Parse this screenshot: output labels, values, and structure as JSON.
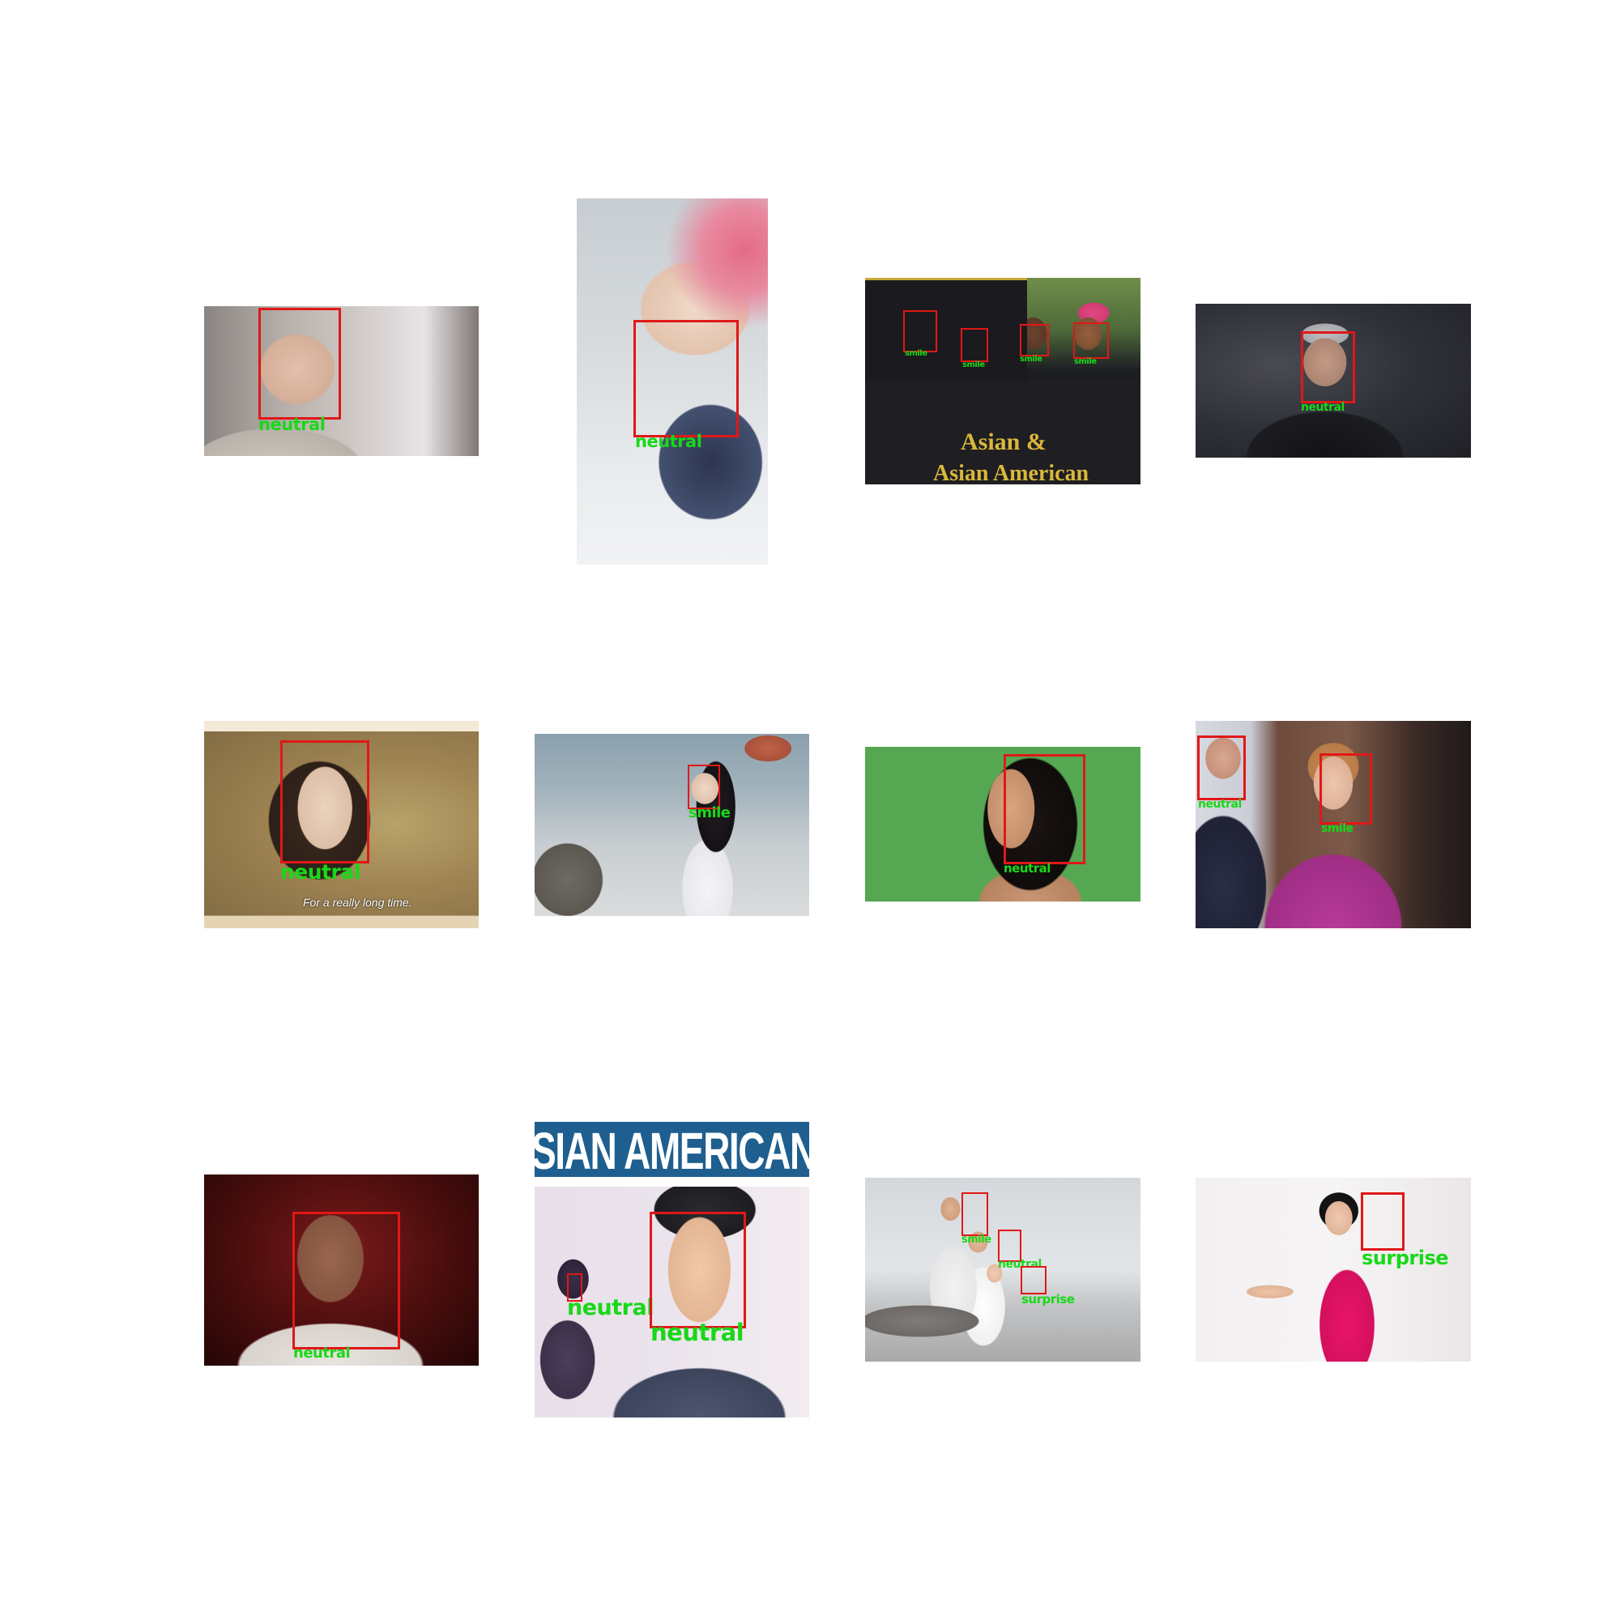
{
  "tiles": [
    {
      "id": "r1c1",
      "faces": [
        {
          "label": "neutral"
        }
      ],
      "overlay": []
    },
    {
      "id": "r1c2",
      "faces": [
        {
          "label": "neutral"
        }
      ],
      "overlay": []
    },
    {
      "id": "r1c3",
      "faces": [
        {
          "label": "smile"
        },
        {
          "label": "smile"
        },
        {
          "label": "smile"
        },
        {
          "label": "smile"
        }
      ],
      "overlay": [
        "Asian &",
        "Asian American"
      ]
    },
    {
      "id": "r1c4",
      "faces": [
        {
          "label": "neutral"
        }
      ],
      "overlay": []
    },
    {
      "id": "r2c1",
      "faces": [
        {
          "label": "neutral"
        }
      ],
      "overlay": [
        "For a really long time."
      ]
    },
    {
      "id": "r2c2",
      "faces": [
        {
          "label": "smile"
        }
      ],
      "overlay": []
    },
    {
      "id": "r2c3",
      "faces": [
        {
          "label": "neutral"
        }
      ],
      "overlay": []
    },
    {
      "id": "r2c4",
      "faces": [
        {
          "label": "neutral"
        },
        {
          "label": "smile"
        }
      ],
      "overlay": []
    },
    {
      "id": "r3c1",
      "faces": [
        {
          "label": "neutral"
        }
      ],
      "overlay": []
    },
    {
      "id": "r3c2",
      "faces": [
        {
          "label": "neutral"
        },
        {
          "label": "neutral"
        }
      ],
      "overlay": [
        "SIAN AMERICAN"
      ]
    },
    {
      "id": "r3c3",
      "faces": [
        {
          "label": "smile"
        },
        {
          "label": "neutral"
        },
        {
          "label": "surprise"
        }
      ],
      "overlay": []
    },
    {
      "id": "r3c4",
      "faces": [
        {
          "label": "surprise"
        }
      ],
      "overlay": []
    }
  ],
  "colors": {
    "box": "#e01818",
    "label": "#18d818",
    "background": "#ffffff"
  }
}
